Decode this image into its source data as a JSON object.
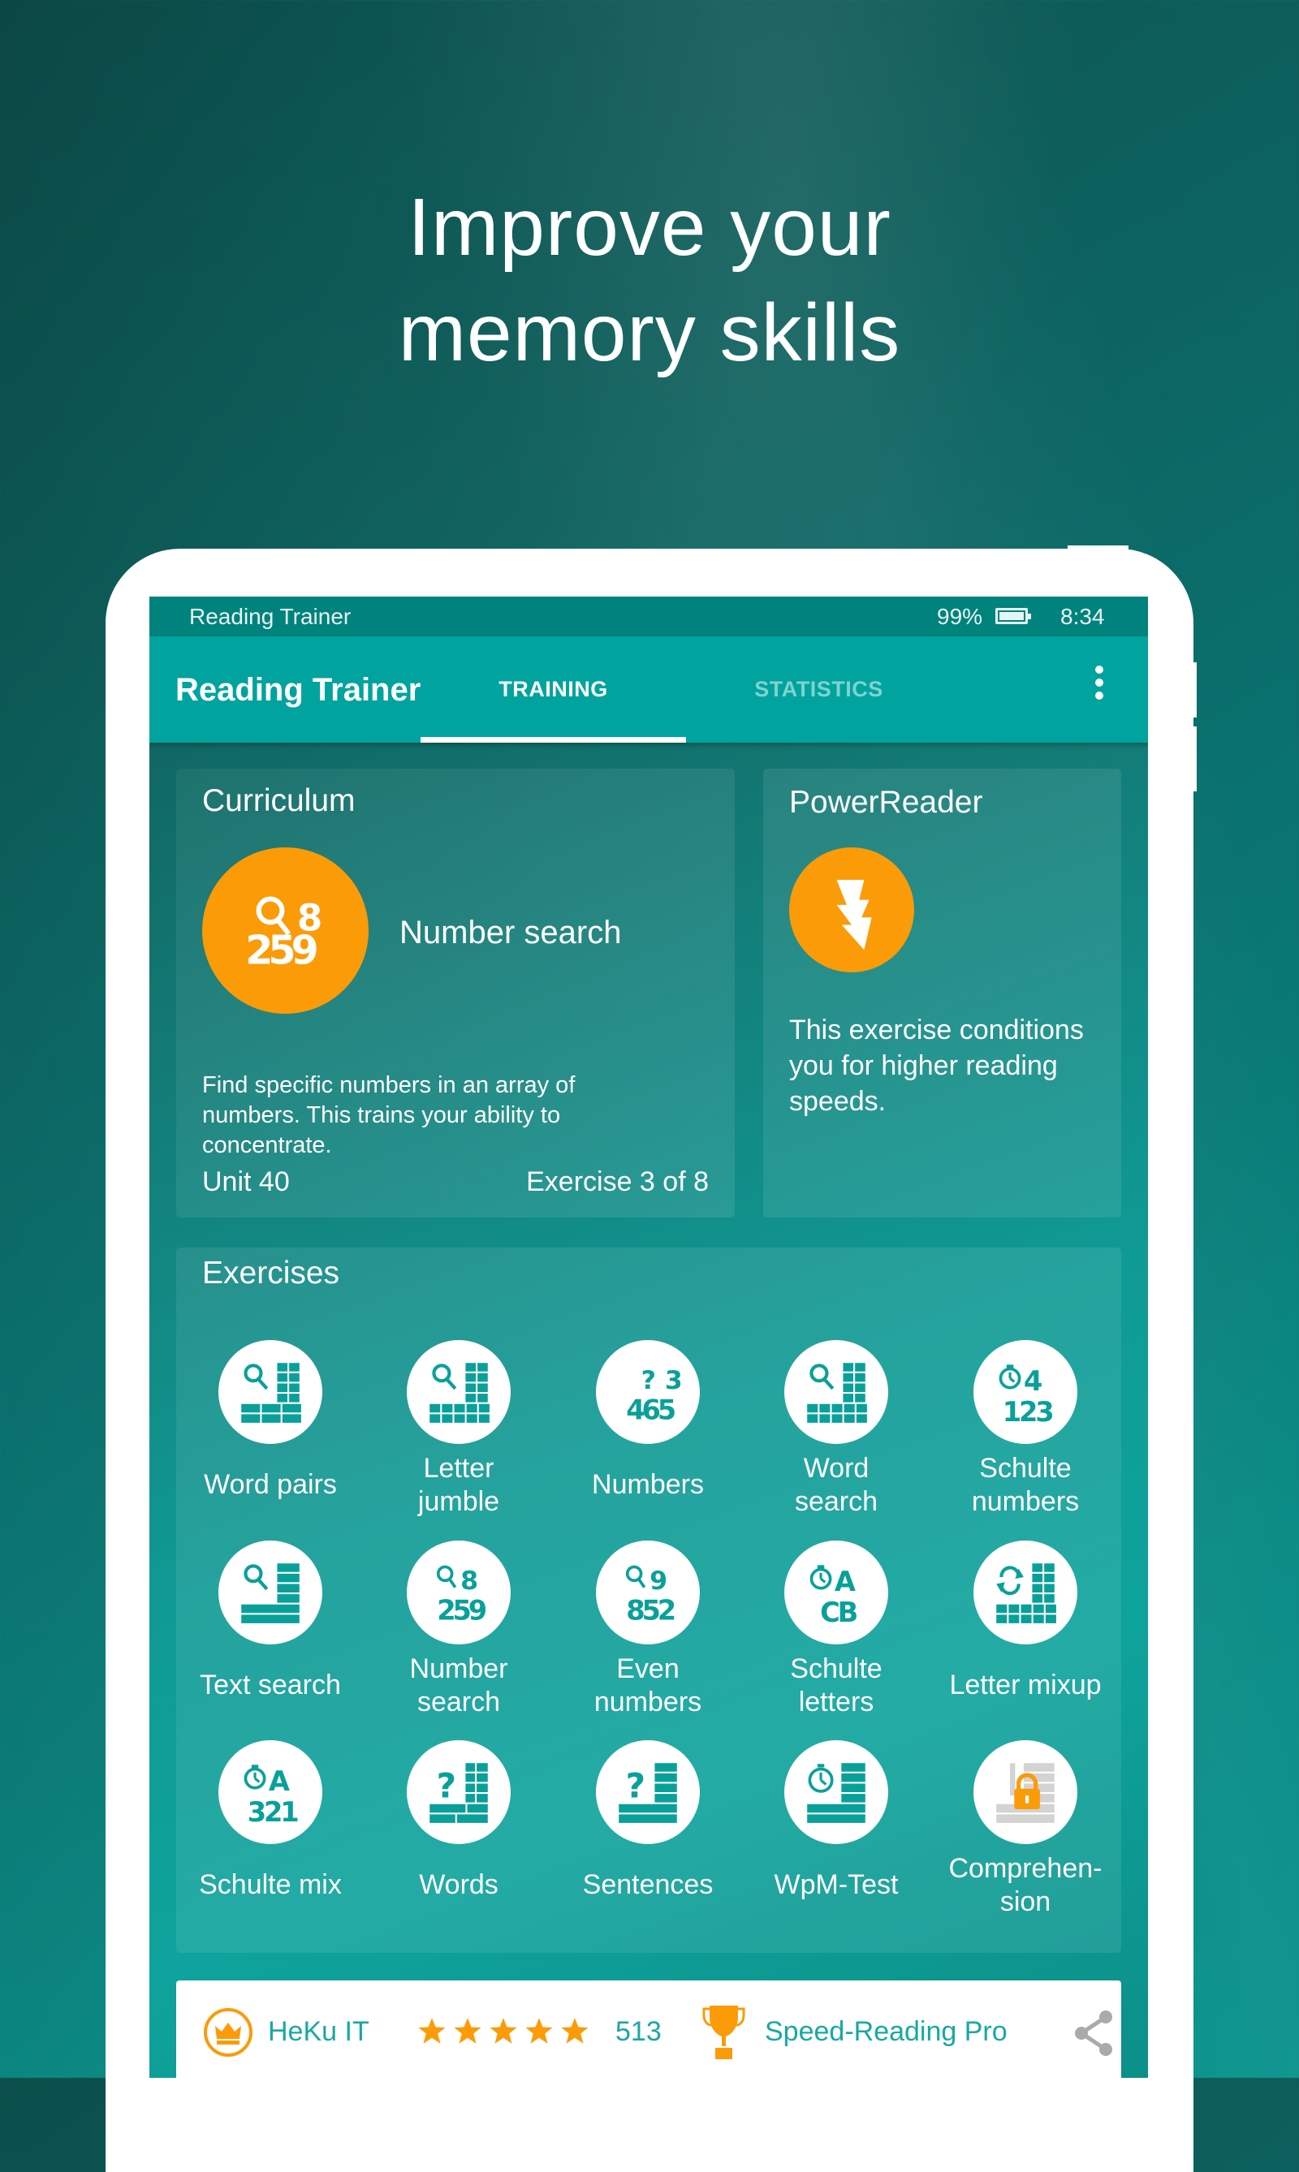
{
  "promo": {
    "headline_line1": "Improve your",
    "headline_line2": "memory skills"
  },
  "statusbar": {
    "app_name": "Reading Trainer",
    "battery": "99%",
    "time": "8:34"
  },
  "appbar": {
    "title": "Reading Trainer",
    "tabs": [
      {
        "label": "TRAINING",
        "active": true
      },
      {
        "label": "STATISTICS",
        "active": false
      }
    ],
    "overflow_icon": "more-vert-icon"
  },
  "curriculum": {
    "heading": "Curriculum",
    "exercise_name": "Number search",
    "icon": "number-search-icon",
    "description": "Find specific numbers in an array of numbers. This trains your ability to concentrate.",
    "unit": "Unit 40",
    "progress": "Exercise 3 of 8"
  },
  "powerreader": {
    "heading": "PowerReader",
    "icon": "lightning-icon",
    "description": "This exercise conditions you for higher reading speeds."
  },
  "exercises": {
    "heading": "Exercises",
    "items": [
      {
        "label": "Word pairs",
        "icon": "word-pairs-icon",
        "locked": false
      },
      {
        "label": "Letter jumble",
        "icon": "letter-jumble-icon",
        "locked": false
      },
      {
        "label": "Numbers",
        "icon": "numbers-icon",
        "locked": false
      },
      {
        "label": "Word search",
        "icon": "word-search-icon",
        "locked": false
      },
      {
        "label": "Schulte numbers",
        "icon": "schulte-numbers-icon",
        "locked": false
      },
      {
        "label": "Text search",
        "icon": "text-search-icon",
        "locked": false
      },
      {
        "label": "Number search",
        "icon": "number-search-icon",
        "locked": false
      },
      {
        "label": "Even numbers",
        "icon": "even-numbers-icon",
        "locked": false
      },
      {
        "label": "Schulte letters",
        "icon": "schulte-letters-icon",
        "locked": false
      },
      {
        "label": "Letter mixup",
        "icon": "letter-mixup-icon",
        "locked": false
      },
      {
        "label": "Schulte mix",
        "icon": "schulte-mix-icon",
        "locked": false
      },
      {
        "label": "Words",
        "icon": "words-icon",
        "locked": false
      },
      {
        "label": "Sentences",
        "icon": "sentences-icon",
        "locked": false
      },
      {
        "label": "WpM-Test",
        "icon": "wpm-test-icon",
        "locked": false
      },
      {
        "label": "Comprehen-sion",
        "icon": "comprehension-icon",
        "locked": true
      }
    ]
  },
  "footer": {
    "developer": "HeKu IT",
    "rating_stars": 5,
    "rating_count": "513",
    "pro_label": "Speed-Reading Pro"
  },
  "colors": {
    "accent_orange": "#fb9b08",
    "teal_primary": "#00a39e",
    "teal_dark": "#00827d",
    "teal_text": "#19a8a2",
    "icon_teal": "#0aa09a"
  }
}
